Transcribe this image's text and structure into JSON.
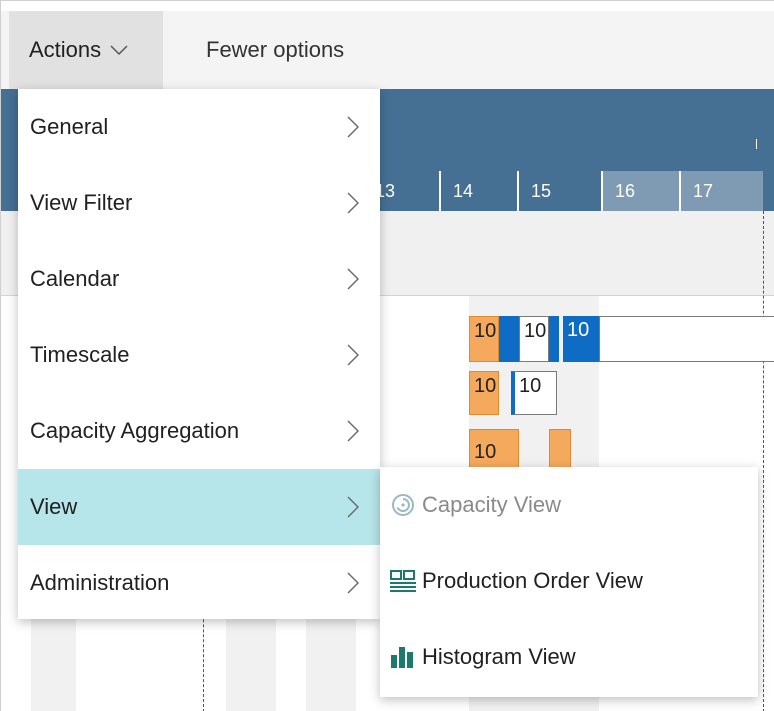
{
  "toolbar": {
    "actions_label": "Actions",
    "fewer_options_label": "Fewer options"
  },
  "gantt": {
    "days": [
      "13",
      "14",
      "15",
      "16",
      "17"
    ],
    "bar_label": "10"
  },
  "menu": {
    "items": [
      {
        "label": "General"
      },
      {
        "label": "View Filter"
      },
      {
        "label": "Calendar"
      },
      {
        "label": "Timescale"
      },
      {
        "label": "Capacity Aggregation"
      },
      {
        "label": "View"
      },
      {
        "label": "Administration"
      }
    ]
  },
  "submenu": {
    "items": [
      {
        "label": "Capacity View",
        "icon": "capacity-view-icon"
      },
      {
        "label": "Production Order View",
        "icon": "production-order-view-icon"
      },
      {
        "label": "Histogram View",
        "icon": "histogram-view-icon"
      }
    ]
  },
  "colors": {
    "header": "#456f93",
    "active_menu": "#b6e5ea",
    "bar_orange": "#f4a95d",
    "bar_blue": "#0f6cc4",
    "icon_teal": "#1a7a6e"
  }
}
